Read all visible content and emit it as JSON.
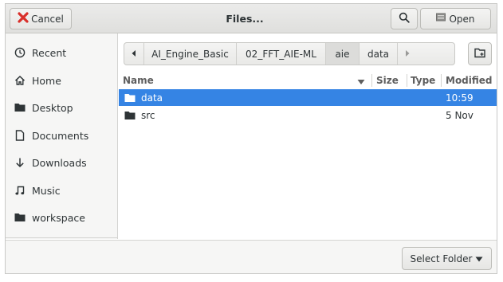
{
  "header": {
    "title": "Files...",
    "cancel_label": "Cancel",
    "open_label": "Open"
  },
  "sidebar": {
    "items": [
      {
        "label": "Recent",
        "icon": "clock-icon"
      },
      {
        "label": "Home",
        "icon": "home-icon"
      },
      {
        "label": "Desktop",
        "icon": "folder-icon"
      },
      {
        "label": "Documents",
        "icon": "document-icon"
      },
      {
        "label": "Downloads",
        "icon": "download-arrow-icon"
      },
      {
        "label": "Music",
        "icon": "music-note-icon"
      },
      {
        "label": "workspace",
        "icon": "folder-icon"
      }
    ]
  },
  "pathbar": {
    "crumbs": [
      "AI_Engine_Basic",
      "02_FFT_AIE-ML",
      "aie",
      "data"
    ],
    "active": "aie"
  },
  "list": {
    "columns": {
      "name": "Name",
      "size": "Size",
      "type": "Type",
      "modified": "Modified"
    },
    "sort": "descending",
    "rows": [
      {
        "name": "data",
        "modified": "10:59",
        "selected": true
      },
      {
        "name": "src",
        "modified": "5 Nov",
        "selected": false
      }
    ]
  },
  "footer": {
    "select_label": "Select Folder"
  },
  "colors": {
    "selection": "#3584e4",
    "header_bg": "#e5e5e3",
    "sidebar_bg": "#f6f6f5"
  }
}
